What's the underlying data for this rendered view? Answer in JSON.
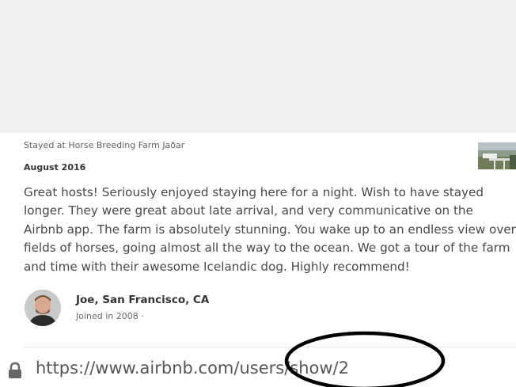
{
  "review": {
    "stayed_at": "Stayed at Horse Breeding Farm Jaðar",
    "date": "August 2016",
    "body_lines": [
      "Great hosts! Seriously enjoyed staying here for a night. Wish to have stayed",
      "longer. They were great about late arrival, and very communicative on the",
      "Airbnb app. The farm is absolutely stunning. You wake up to an endless view over",
      "fields of horses, going almost all the way to the ocean. We got a tour of the farm",
      "and time with their awesome Icelandic dog. Highly recommend!"
    ],
    "author": "Joe, San Francisco, CA",
    "joined": "Joined in 2008 ·"
  },
  "address_bar": {
    "url": "https://www.airbnb.com/users/show/2",
    "lock_icon": "lock-icon"
  },
  "colors": {
    "top_band": "#f0f0f0",
    "text": "#484848",
    "annotation_circle": "#000000"
  }
}
